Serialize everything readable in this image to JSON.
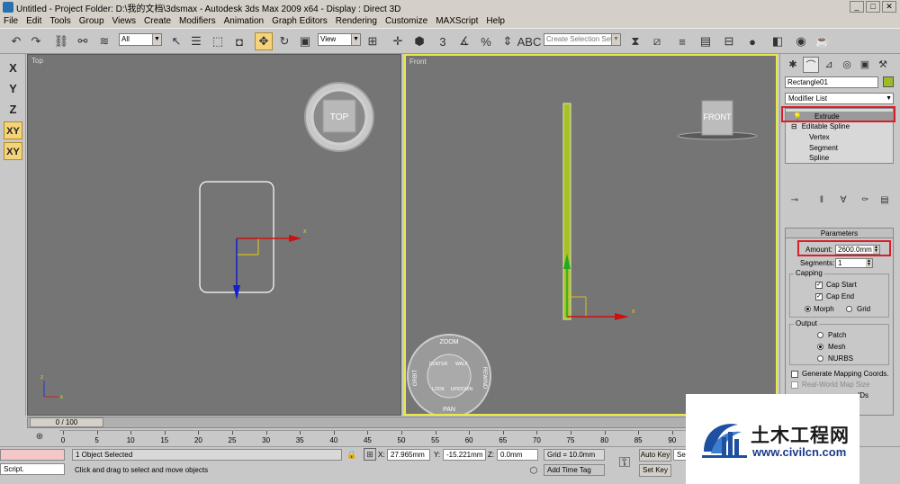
{
  "window": {
    "title": "Untitled    - Project Folder: D:\\我的文档\\3dsmax    - Autodesk 3ds Max  2009 x64    - Display : Direct 3D",
    "min_label": "_",
    "max_label": "□",
    "close_label": "✕"
  },
  "menu": [
    "File",
    "Edit",
    "Tools",
    "Group",
    "Views",
    "Create",
    "Modifiers",
    "Animation",
    "Graph Editors",
    "Rendering",
    "Customize",
    "MAXScript",
    "Help"
  ],
  "toolbar": {
    "selection_filter": "All",
    "ref_coord": "View",
    "named_selection_placeholder": "Create Selection Set"
  },
  "axis_buttons": [
    "X",
    "Y",
    "Z",
    "XY",
    "XY"
  ],
  "viewports": {
    "top": {
      "label": "Top",
      "viewcube": "TOP"
    },
    "front": {
      "label": "Front",
      "viewcube": "FRONT"
    },
    "wheel": {
      "zoom": "ZOOM",
      "pan": "PAN",
      "orbit": "ORBIT",
      "rewind": "REWIND",
      "center": "CENTER",
      "walk": "WALK",
      "look": "LOOK",
      "updown": "UP/DOWN"
    }
  },
  "command_panel": {
    "object_name": "Rectangle01",
    "object_color": "#9dba2a",
    "modifier_list": "Modifier List",
    "stack": [
      {
        "label": "Extrude",
        "selected": true
      },
      {
        "label": "Editable Spline",
        "selected": false
      },
      {
        "label": "Vertex",
        "selected": false
      },
      {
        "label": "Segment",
        "selected": false
      },
      {
        "label": "Spline",
        "selected": false
      }
    ],
    "parameters": {
      "header": "Parameters",
      "amount_label": "Amount:",
      "amount_value": "2600.0mm",
      "segments_label": "Segments:",
      "segments_value": "1",
      "capping_title": "Capping",
      "cap_start": "Cap Start",
      "cap_end": "Cap End",
      "morph": "Morph",
      "grid": "Grid",
      "output_title": "Output",
      "patch": "Patch",
      "mesh": "Mesh",
      "nurbs": "NURBS",
      "gen_mapping": "Generate Mapping Coords.",
      "real_world": "Real-World Map Size",
      "gen_ids": "IDs"
    }
  },
  "timeline": {
    "slider_label": "0 / 100",
    "ticks": [
      "0",
      "5",
      "10",
      "15",
      "20",
      "25",
      "30",
      "35",
      "40",
      "45",
      "50",
      "55",
      "60",
      "65",
      "70",
      "75",
      "80",
      "85",
      "90"
    ]
  },
  "status": {
    "selected": "1 Object Selected",
    "prompt": "Click and drag to select and move objects",
    "script": "Script.",
    "x_label": "X:",
    "x_value": "27.965mm",
    "y_label": "Y:",
    "y_value": "-15.221mm",
    "z_label": "Z:",
    "z_value": "0.0mm",
    "grid": "Grid = 10.0mm",
    "add_time_tag": "Add Time Tag",
    "auto_key": "Auto Key",
    "set_key": "Set Key",
    "sel": "Sel"
  },
  "watermark": {
    "title": "土木工程网",
    "url": "www.civilcn.com"
  }
}
